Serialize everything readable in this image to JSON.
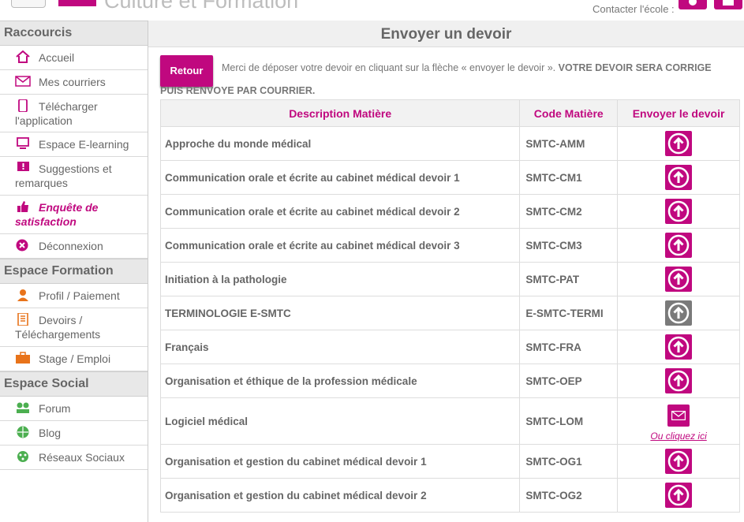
{
  "header": {
    "brand": "Culture et Formation",
    "contact_label": "Contacter l'école :",
    "icons": [
      "menu-icon",
      "phone-icon",
      "mail-icon"
    ]
  },
  "sidebar": {
    "section1": "Raccourcis",
    "raccourcis": [
      {
        "label": "Accueil",
        "icon": "home-icon"
      },
      {
        "label": "Mes courriers",
        "icon": "envelope-icon"
      },
      {
        "label": "Télécharger l'application",
        "icon": "mobile-icon"
      },
      {
        "label": "Espace E-learning",
        "icon": "monitor-icon"
      },
      {
        "label": "Suggestions et remarques",
        "icon": "comment-alert-icon"
      },
      {
        "label": "Enquête de satisfaction",
        "icon": "thumbs-up-icon"
      },
      {
        "label": "Déconnexion",
        "icon": "close-circle-icon"
      }
    ],
    "section2": "Espace Formation",
    "formation": [
      {
        "label": "Profil / Paiement",
        "icon": "user-icon"
      },
      {
        "label": "Devoirs / Téléchargements",
        "icon": "document-icon"
      },
      {
        "label": "Stage / Emploi",
        "icon": "briefcase-icon"
      }
    ],
    "section3": "Espace Social",
    "social": [
      {
        "label": "Forum",
        "icon": "users-icon"
      },
      {
        "label": "Blog",
        "icon": "globe-icon"
      },
      {
        "label": "Réseaux Sociaux",
        "icon": "network-icon"
      }
    ]
  },
  "main": {
    "title": "Envoyer un devoir",
    "retour": "Retour",
    "intro": "Merci de déposer votre devoir en cliquant sur la flèche « envoyer le devoir ».",
    "intro_caps_a": "VOTRE DEVOIR SERA CORRIGE",
    "intro_caps_b": "PUIS RENVOYE PAR COURRIER.",
    "columns": [
      "Description Matière",
      "Code Matière",
      "Envoyer le devoir"
    ],
    "rows": [
      {
        "desc": "Approche du monde médical",
        "code": "SMTC-AMM",
        "action": "upload"
      },
      {
        "desc": "Communication orale et écrite au cabinet médical devoir 1",
        "code": "SMTC-CM1",
        "action": "upload"
      },
      {
        "desc": "Communication orale et écrite au cabinet médical devoir 2",
        "code": "SMTC-CM2",
        "action": "upload"
      },
      {
        "desc": "Communication orale et écrite au cabinet médical devoir 3",
        "code": "SMTC-CM3",
        "action": "upload"
      },
      {
        "desc": "Initiation à la pathologie",
        "code": "SMTC-PAT",
        "action": "upload"
      },
      {
        "desc": "TERMINOLOGIE E-SMTC",
        "code": "E-SMTC-TERMI",
        "action": "upload-disabled"
      },
      {
        "desc": "Français",
        "code": "SMTC-FRA",
        "action": "upload"
      },
      {
        "desc": "Organisation et éthique de la profession médicale",
        "code": "SMTC-OEP",
        "action": "upload"
      },
      {
        "desc": "Logiciel médical",
        "code": "SMTC-LOM",
        "action": "mail",
        "alt_link": "Ou cliquez ici"
      },
      {
        "desc": "Organisation et gestion du cabinet médical devoir 1",
        "code": "SMTC-OG1",
        "action": "upload"
      },
      {
        "desc": "Organisation et gestion du cabinet médical devoir 2",
        "code": "SMTC-OG2",
        "action": "upload"
      }
    ]
  },
  "colors": {
    "accent": "#c0087f",
    "disabled": "#7a7a7a",
    "text": "#666666",
    "section_bg": "#e8e8e8"
  }
}
